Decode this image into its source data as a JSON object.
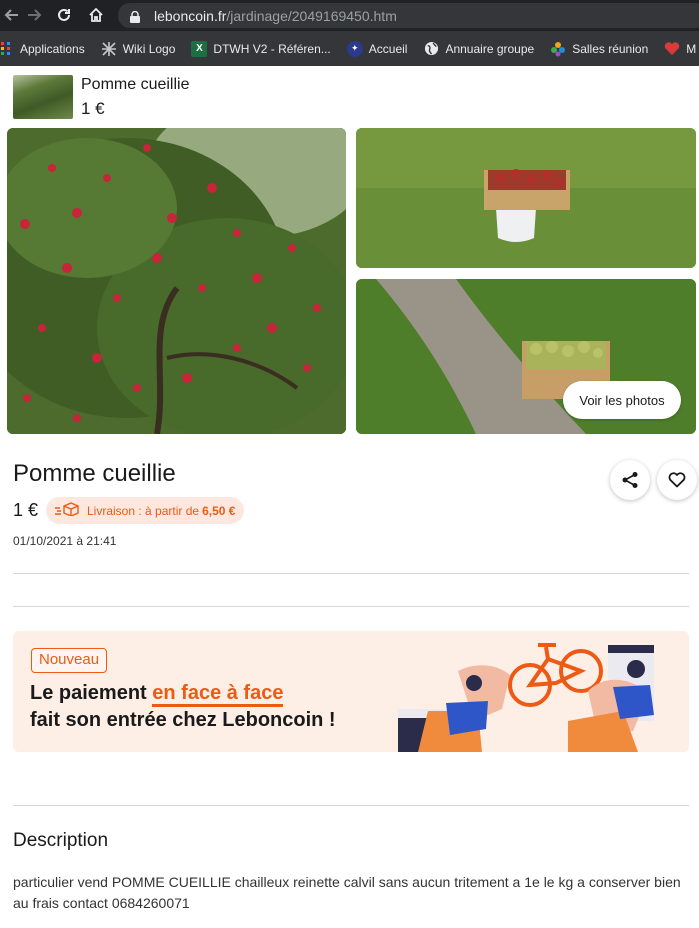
{
  "browser": {
    "url_domain": "leboncoin.fr",
    "url_path": "/jardinage/2049169450.htm",
    "bookmarks": [
      {
        "label": "Applications",
        "icon": "apps-grid-icon"
      },
      {
        "label": "Wiki Logo",
        "icon": "wiki-icon"
      },
      {
        "label": "DTWH V2 - Référen...",
        "icon": "excel-icon"
      },
      {
        "label": "Accueil",
        "icon": "accueil-icon"
      },
      {
        "label": "Annuaire groupe",
        "icon": "globe-icon"
      },
      {
        "label": "Salles réunion",
        "icon": "flower-icon"
      },
      {
        "label": "M",
        "icon": "heart-icon"
      }
    ]
  },
  "sticky": {
    "title": "Pomme cueillie",
    "price": "1 €"
  },
  "gallery": {
    "see_photos": "Voir les photos"
  },
  "ad": {
    "title": "Pomme cueillie",
    "price": "1 €",
    "delivery_label": "Livraison : à partir de",
    "delivery_amount": "6,50 €",
    "date": "01/10/2021 à 21:41"
  },
  "promo": {
    "badge": "Nouveau",
    "line1_prefix": "Le paiement ",
    "line1_highlight": "en face à face",
    "line2": "fait son entrée chez Leboncoin !"
  },
  "description": {
    "title": "Description",
    "text": "particulier vend POMME CUEILLIE chailleux reinette calvil sans aucun tritement a 1e le kg a conserver bien au frais contact 0684260071"
  },
  "colors": {
    "brand_orange": "#ec5a13",
    "promo_bg": "#fdeee6",
    "chrome_dark": "#202124"
  }
}
